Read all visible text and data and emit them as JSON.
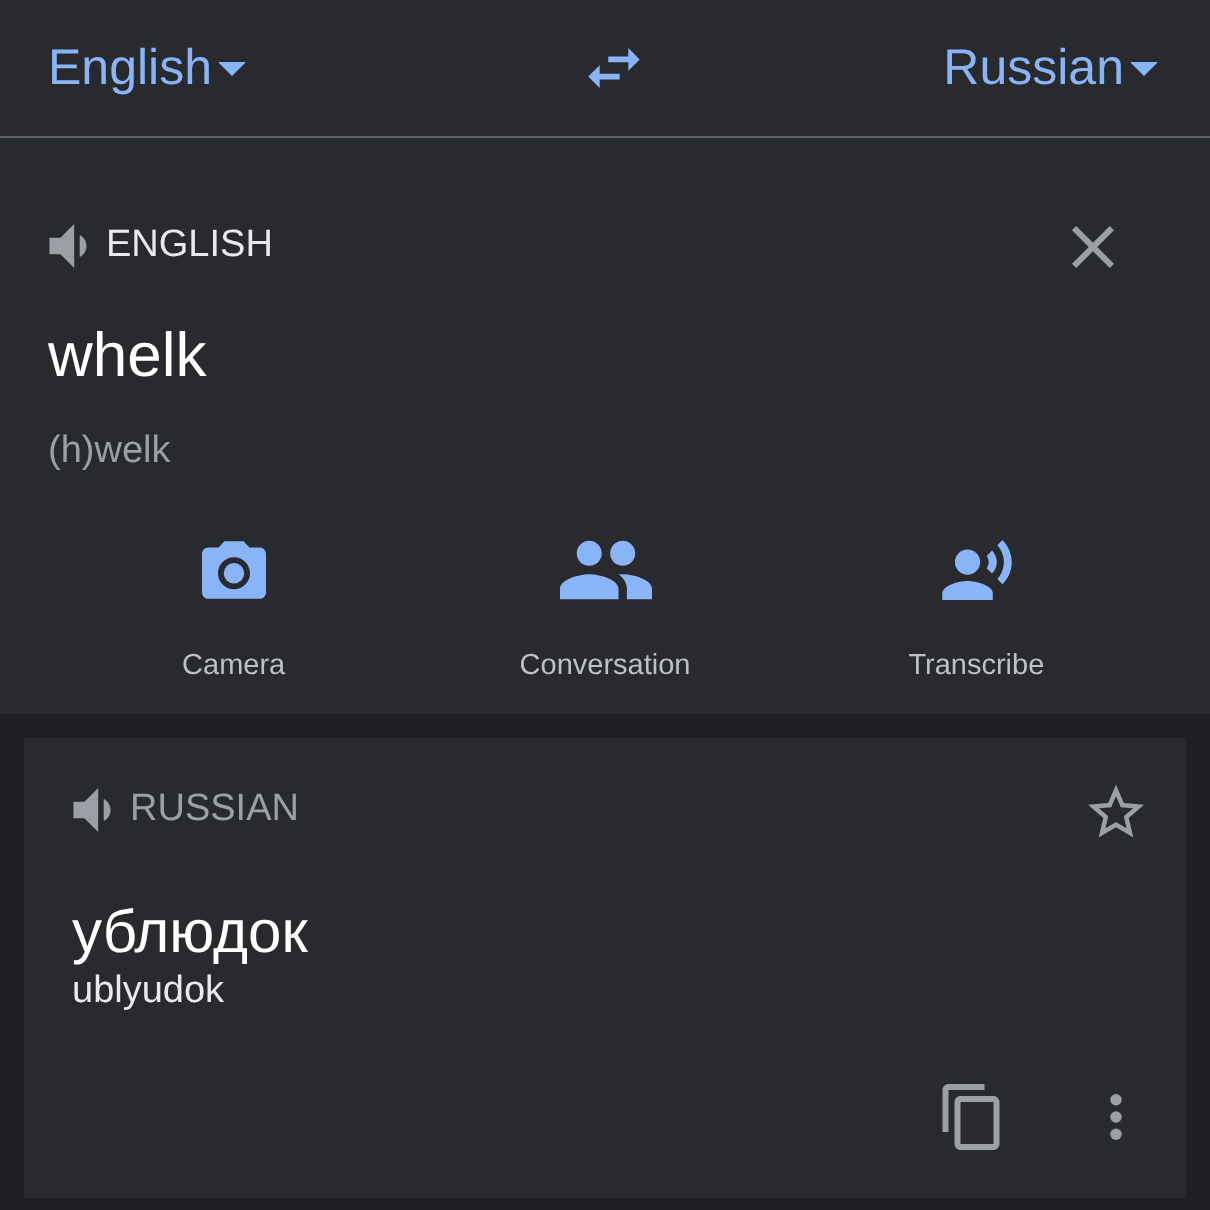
{
  "top_bar": {
    "source_language": "English",
    "target_language": "Russian"
  },
  "source": {
    "language_label": "ENGLISH",
    "text": "whelk",
    "transliteration": "(h)welk"
  },
  "tools": [
    {
      "kind": "camera",
      "label": "Camera"
    },
    {
      "kind": "conversation",
      "label": "Conversation"
    },
    {
      "kind": "transcribe",
      "label": "Transcribe"
    }
  ],
  "result": {
    "language_label": "RUSSIAN",
    "starred": false,
    "text": "ублюдок",
    "transliteration": "ublyudok"
  }
}
